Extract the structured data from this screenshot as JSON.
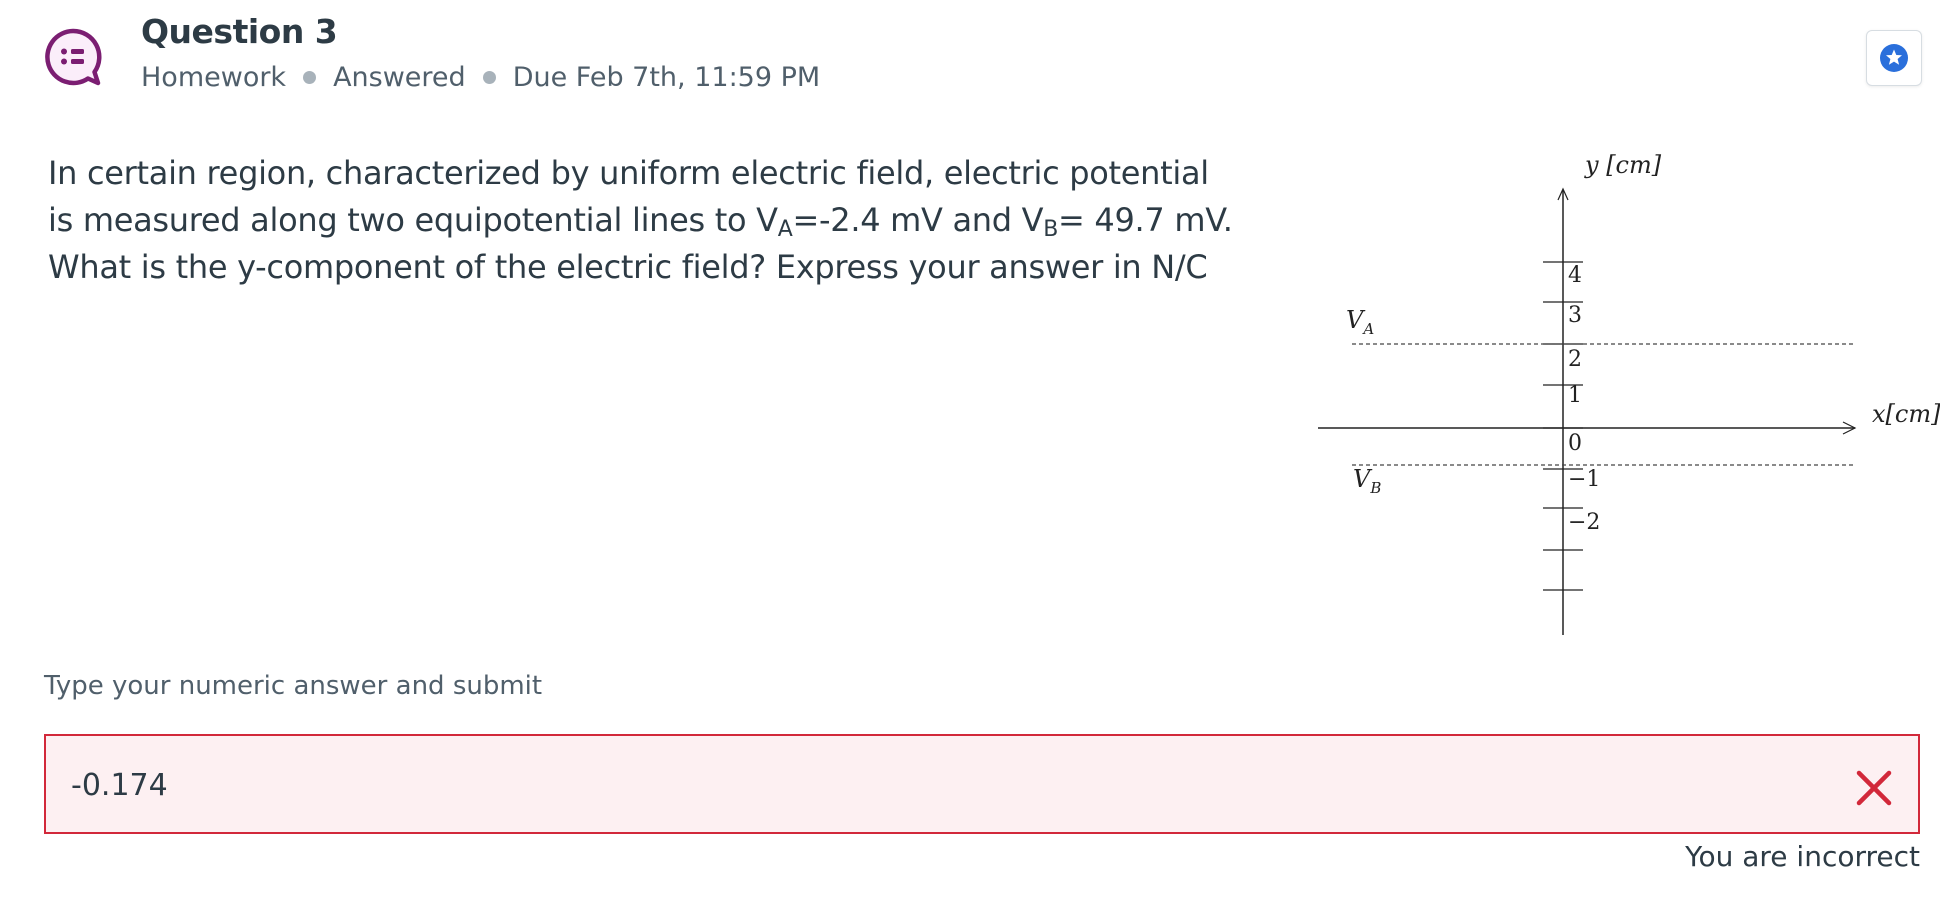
{
  "question": {
    "title": "Question 3",
    "meta": [
      "Homework",
      "Answered",
      "Due Feb 7th, 11:59 PM"
    ]
  },
  "body": {
    "line1": "In certain region, characterized by uniform electric field, electric potential",
    "line2_prefix": " is measured along two equipotential lines to  V",
    "va_sub": "A",
    "line2_mid": "=-2.4 mV and V",
    "vb_sub": "B",
    "line2_suffix": "= 49.7 mV.",
    "line3": "What is the y-component of the electric field? Express your answer in N/C"
  },
  "figure": {
    "y_axis_label": "y [cm]",
    "x_axis_label": "x[cm]",
    "va_label": "V",
    "va_sub": "A",
    "vb_label": "V",
    "vb_sub": "B",
    "tick_labels": [
      "4",
      "3",
      "2",
      "1",
      "0",
      "−1",
      "−2"
    ]
  },
  "answer": {
    "prompt": "Type your numeric answer and submit",
    "value": "-0.174",
    "feedback": "You are incorrect"
  },
  "colors": {
    "icon_purple": "#7b1e72",
    "error_red": "#d2283a",
    "error_bg": "#fdf0f2",
    "bookmark_blue": "#2a6fdb"
  },
  "icons": {
    "question_type": "list-bubble-icon",
    "bookmark": "star-icon",
    "result": "close-icon"
  }
}
